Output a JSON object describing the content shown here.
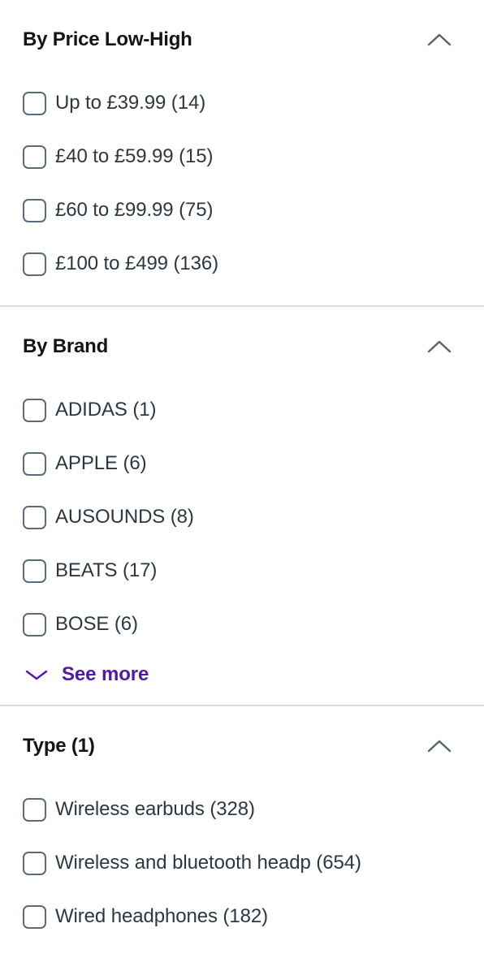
{
  "colors": {
    "accent_purple": "#5417ad",
    "heading": "#111418",
    "label": "#2b3843",
    "checkbox_border": "#5b6b7a",
    "divider": "#d5dce2",
    "chevron": "#55646f",
    "background": "#ffffff"
  },
  "facets": [
    {
      "id": "price",
      "title": "By Price Low-High",
      "collapse_icon": "chevron-up-icon",
      "expanded": true,
      "options": [
        {
          "label": "Up to £39.99 (14)",
          "checked": false
        },
        {
          "label": "£40 to £59.99 (15)",
          "checked": false
        },
        {
          "label": "£60 to £99.99 (75)",
          "checked": false
        },
        {
          "label": "£100 to £499 (136)",
          "checked": false
        }
      ],
      "see_more": null
    },
    {
      "id": "brand",
      "title": "By Brand",
      "collapse_icon": "chevron-up-icon",
      "expanded": true,
      "options": [
        {
          "label": "ADIDAS (1)",
          "checked": false
        },
        {
          "label": "APPLE (6)",
          "checked": false
        },
        {
          "label": "AUSOUNDS (8)",
          "checked": false
        },
        {
          "label": "BEATS (17)",
          "checked": false
        },
        {
          "label": "BOSE (6)",
          "checked": false
        }
      ],
      "see_more": {
        "label": "See more",
        "icon": "chevron-down-icon"
      }
    },
    {
      "id": "type",
      "title": "Type (1)",
      "collapse_icon": "chevron-up-icon",
      "expanded": true,
      "options": [
        {
          "label": "Wireless earbuds (328)",
          "checked": false
        },
        {
          "label": "Wireless and bluetooth headp (654)",
          "checked": false
        },
        {
          "label": "Wired headphones (182)",
          "checked": false
        }
      ],
      "see_more": null
    }
  ]
}
